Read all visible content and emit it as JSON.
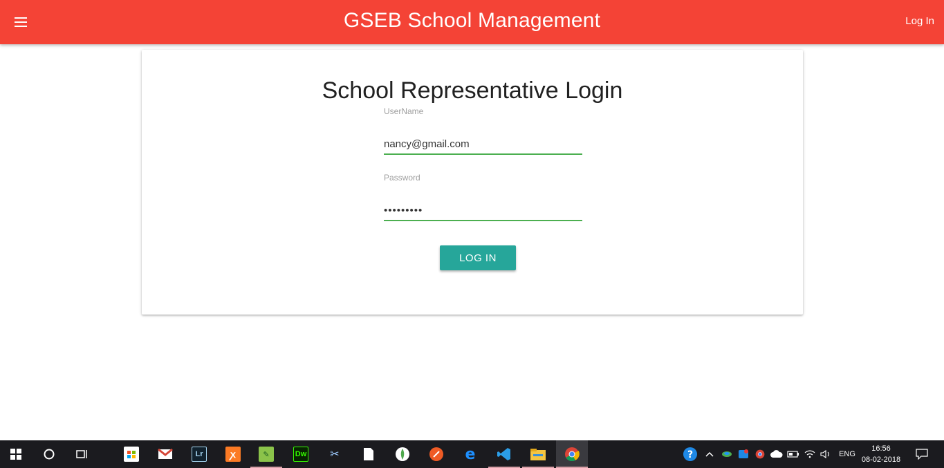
{
  "app": {
    "title": "GSEB School Management",
    "login_link": "Log In",
    "menu_icon": "hamburger-menu-icon",
    "bar_color": "#f44336"
  },
  "form": {
    "title": "School Representative Login",
    "username_label": "UserName",
    "username_value": "nancy@gmail.com",
    "password_label": "Password",
    "password_value": "•••••••••",
    "submit_label": "LOG IN",
    "button_color": "#26a69a",
    "underline_color": "#4caf50"
  },
  "taskbar": {
    "icons": [
      "windows-start-icon",
      "cortana-search-icon",
      "task-view-icon",
      "store-icon",
      "mail-icon",
      "lightroom-icon",
      "xampp-icon",
      "notepad-plus-icon",
      "dreamweaver-icon",
      "snipping-tool-icon",
      "file-icon",
      "mongodb-icon",
      "postman-icon",
      "edge-icon",
      "vscode-icon",
      "file-explorer-icon",
      "chrome-icon"
    ],
    "tray": {
      "language": "ENG",
      "time": "16:56",
      "date": "08-02-2018"
    }
  }
}
